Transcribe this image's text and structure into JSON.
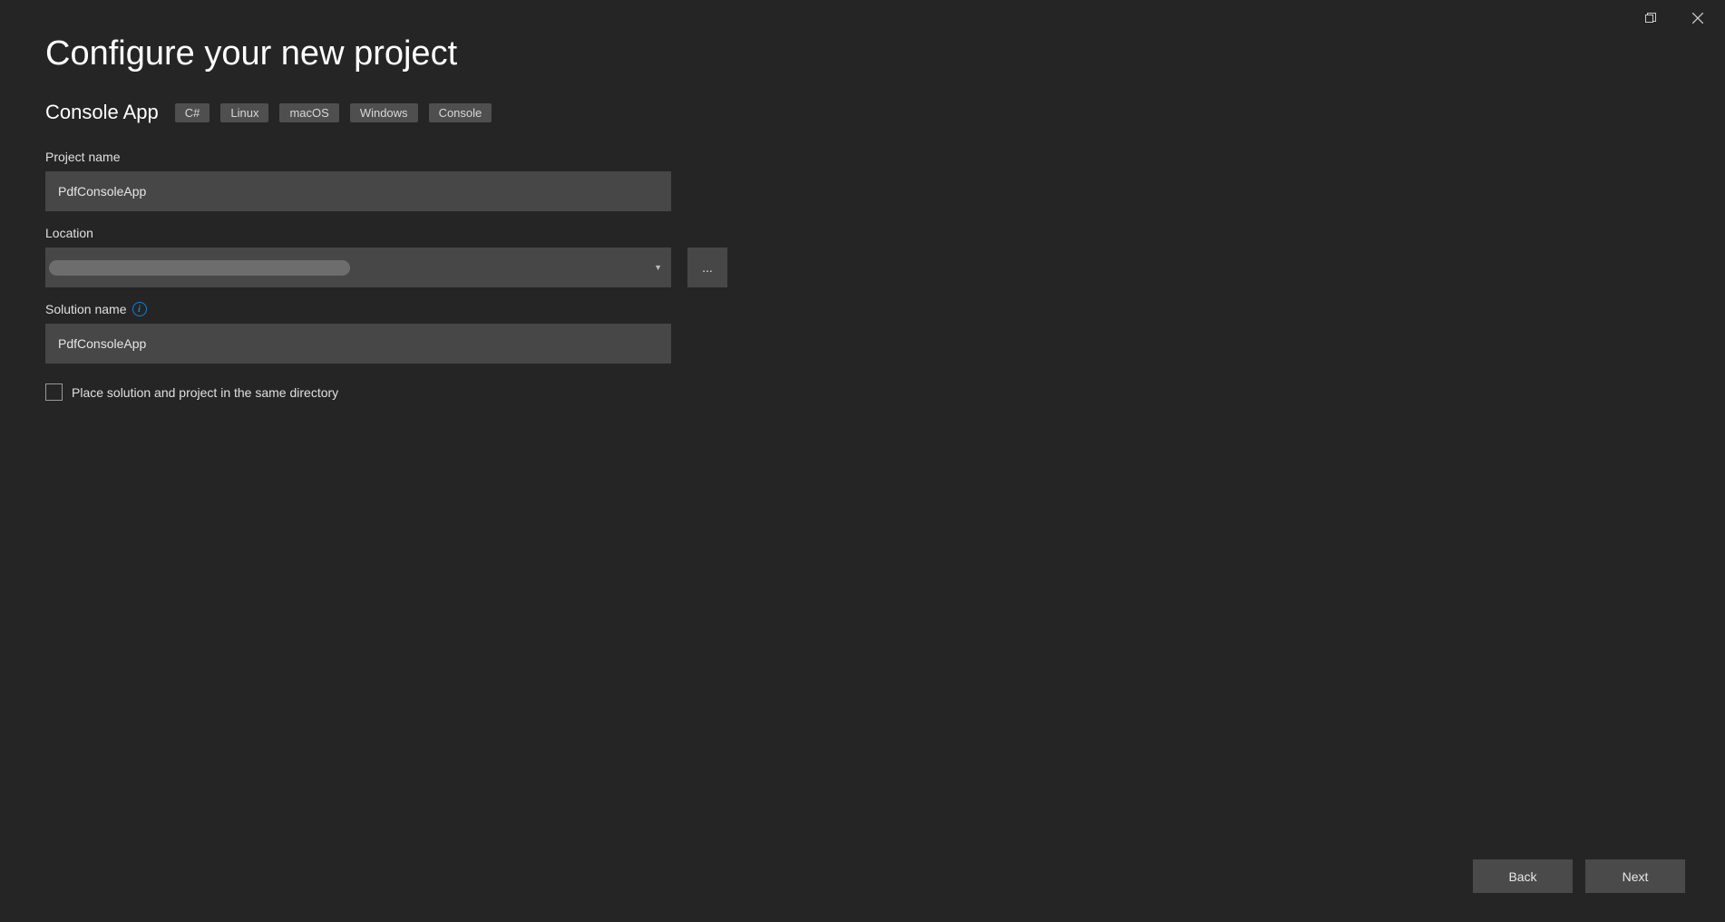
{
  "titleBar": {
    "maximizeIcon": "maximize",
    "closeIcon": "close"
  },
  "header": {
    "title": "Configure your new project"
  },
  "projectType": {
    "name": "Console App",
    "tags": [
      "C#",
      "Linux",
      "macOS",
      "Windows",
      "Console"
    ]
  },
  "fields": {
    "projectName": {
      "label": "Project name",
      "value": "PdfConsoleApp"
    },
    "location": {
      "label": "Location",
      "value": "",
      "browseLabel": "..."
    },
    "solutionName": {
      "label": "Solution name",
      "value": "PdfConsoleApp"
    },
    "placeSolution": {
      "label": "Place solution and project in the same directory",
      "checked": false
    }
  },
  "footer": {
    "back": "Back",
    "next": "Next"
  }
}
